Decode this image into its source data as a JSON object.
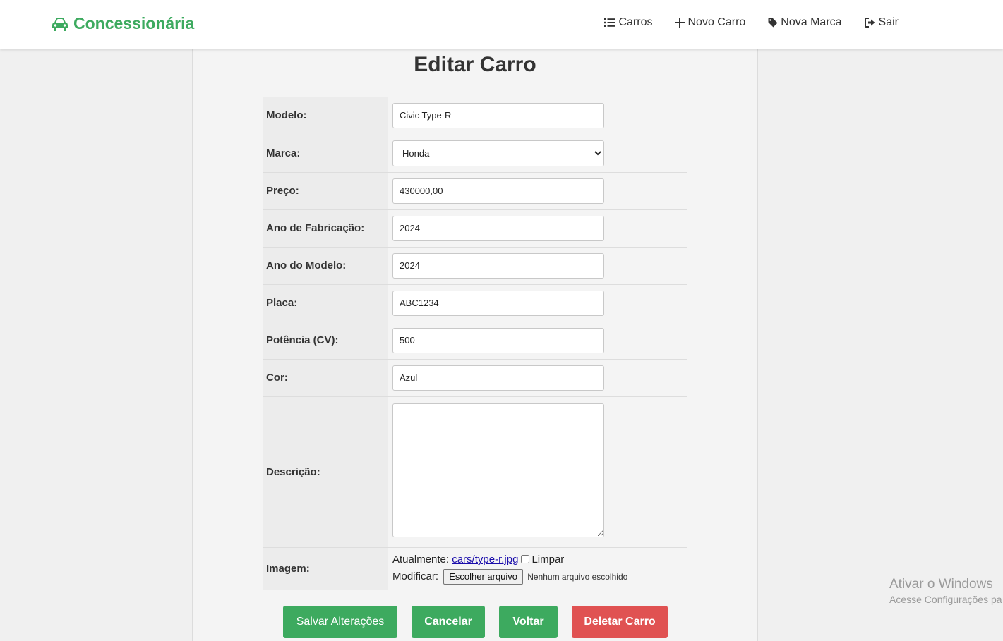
{
  "navbar": {
    "brand": "Concessionária",
    "links": [
      {
        "label": "Carros",
        "icon": "list-icon"
      },
      {
        "label": "Novo Carro",
        "icon": "plus-icon"
      },
      {
        "label": "Nova Marca",
        "icon": "tag-icon"
      },
      {
        "label": "Sair",
        "icon": "sign-out-icon"
      }
    ],
    "brand_color": "#3daa5f"
  },
  "page": {
    "title": "Editar Carro"
  },
  "form": {
    "modelo": {
      "label": "Modelo:",
      "value": "Civic Type-R"
    },
    "marca": {
      "label": "Marca:",
      "value": "Honda"
    },
    "preco": {
      "label": "Preço:",
      "value": "430000,00"
    },
    "ano_fabricacao": {
      "label": "Ano de Fabricação:",
      "value": "2024"
    },
    "ano_modelo": {
      "label": "Ano do Modelo:",
      "value": "2024"
    },
    "placa": {
      "label": "Placa:",
      "value": "ABC1234"
    },
    "potencia": {
      "label": "Potência (CV):",
      "value": "500"
    },
    "cor": {
      "label": "Cor:",
      "value": "Azul"
    },
    "descricao": {
      "label": "Descrição:",
      "value": ""
    },
    "imagem": {
      "label": "Imagem:",
      "current_prefix": "Atualmente:",
      "current_file": "cars/type-r.jpg",
      "clear_label": "Limpar",
      "modify_prefix": "Modificar:",
      "choose_button": "Escolher arquivo",
      "no_file": "Nenhum arquivo escolhido"
    }
  },
  "buttons": {
    "save": "Salvar Alterações",
    "cancel": "Cancelar",
    "back": "Voltar",
    "delete": "Deletar Carro"
  },
  "colors": {
    "primary": "#3daa5f",
    "danger": "#e05252"
  },
  "watermark": {
    "line1": "Ativar o Windows",
    "line2": "Acesse Configurações pa"
  }
}
